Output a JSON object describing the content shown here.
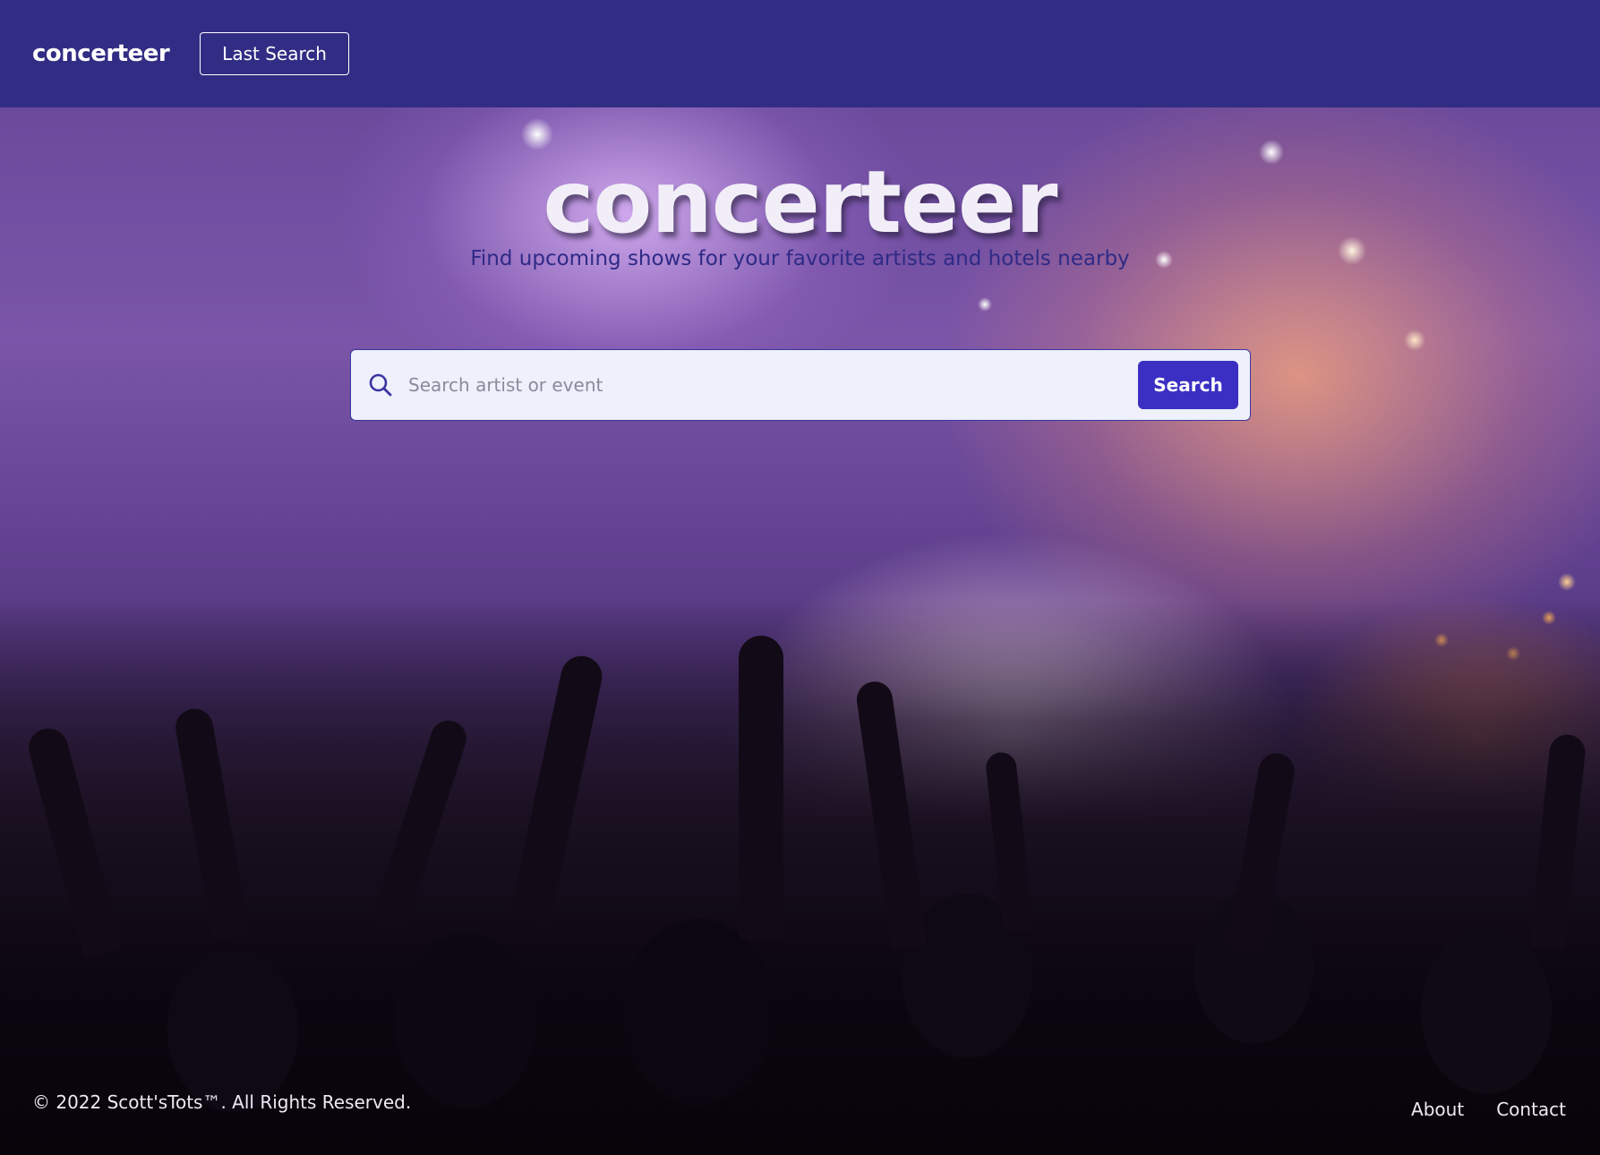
{
  "navbar": {
    "brand": "concerteer",
    "last_search_label": "Last Search",
    "background_color": "#322d84"
  },
  "hero": {
    "title": "concerteer",
    "subtitle": "Find upcoming shows for your favorite artists and hotels nearby",
    "background": "concert crowd with raised hands and stage lights"
  },
  "search": {
    "icon": "search-icon",
    "placeholder": "Search artist or event",
    "value": "",
    "button_label": "Search",
    "button_color": "#3a2fc2"
  },
  "footer": {
    "copyright": "© 2022 Scott'sTots™. All Rights Reserved.",
    "links": [
      {
        "label": "About"
      },
      {
        "label": "Contact"
      }
    ]
  }
}
